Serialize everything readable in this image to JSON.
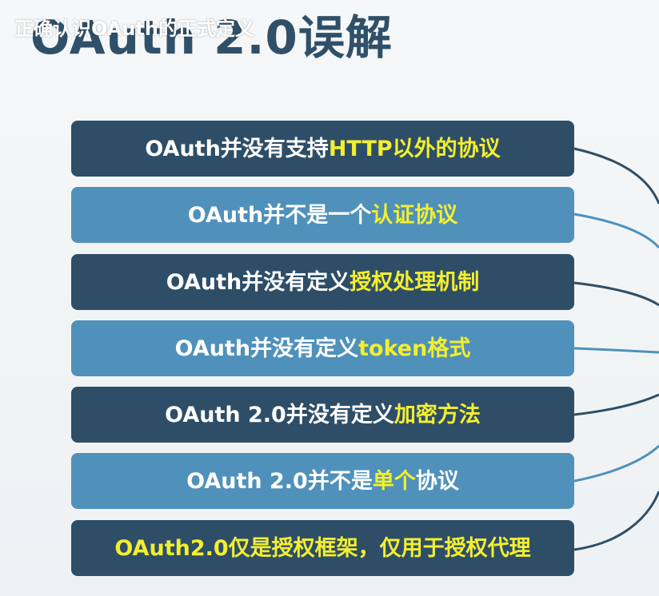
{
  "slide": {
    "title": "OAuth 2.0误解",
    "subtitle": "正确认识OAuth的正式定义",
    "items": [
      {
        "before": "OAuth并没有支持",
        "highlight": "HTTP以外的协议",
        "after": "",
        "style": "dark"
      },
      {
        "before": "OAuth并不是一个",
        "highlight": "认证协议",
        "after": "",
        "style": "light"
      },
      {
        "before": "OAuth并没有定义",
        "highlight": "授权处理机制",
        "after": "",
        "style": "dark"
      },
      {
        "before": "OAuth并没有定义",
        "highlight": "token格式",
        "after": "",
        "style": "light"
      },
      {
        "before": "OAuth 2.0并没有定义",
        "highlight": "加密方法",
        "after": "",
        "style": "dark"
      },
      {
        "before": "OAuth 2.0并不是",
        "highlight": "单个",
        "after": "协议",
        "style": "light"
      },
      {
        "before": "",
        "highlight": "OAuth2.0仅是授权框架，仅用于授权代理",
        "after": "",
        "style": "dark"
      }
    ]
  },
  "colors": {
    "dark_box": "#2e4e67",
    "light_box": "#4f91bb",
    "highlight": "#f3ef2f",
    "title": "#2f5068"
  }
}
